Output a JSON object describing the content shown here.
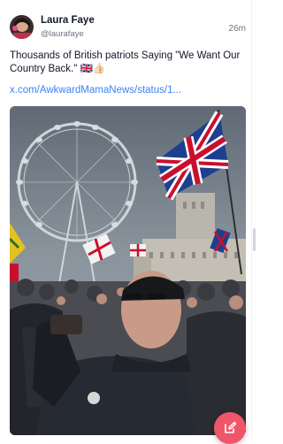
{
  "post": {
    "author_name": "Laura Faye",
    "author_handle": "@laurafaye",
    "time_ago": "26m",
    "text": "Thousands of British patriots Saying \"We Want Our Country Back.\" 🇬🇧👍🏻",
    "link": "x.com/AwkwardMamaNews/status/1..."
  },
  "compose": {
    "icon": "edit-icon"
  },
  "colors": {
    "accent_link": "#3b82f6",
    "fab": "#f0566a"
  }
}
